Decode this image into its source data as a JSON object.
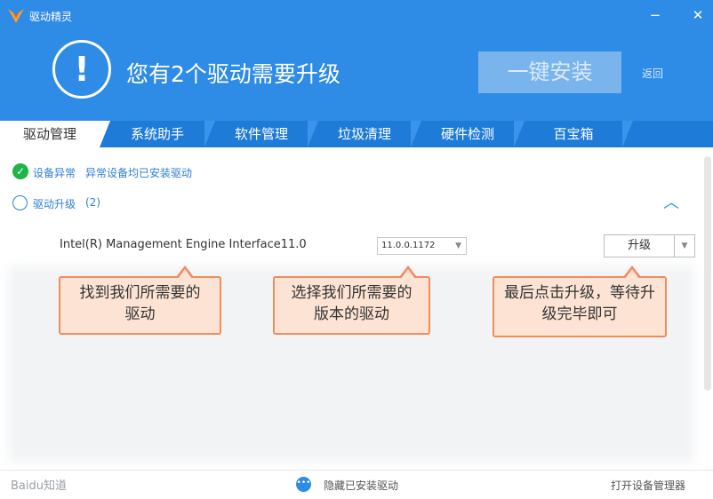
{
  "window": {
    "app_title": "驱动精灵",
    "minimize_glyph": "−",
    "close_glyph": "✕",
    "logo_icon": "app-logo-icon"
  },
  "header": {
    "alert_glyph": "!",
    "headline": "您有2个驱动需要升级",
    "install_button": "一键安装",
    "back_link": "返回"
  },
  "tabs": [
    {
      "label": "驱动管理",
      "active": true
    },
    {
      "label": "系统助手",
      "active": false
    },
    {
      "label": "软件管理",
      "active": false
    },
    {
      "label": "垃圾清理",
      "active": false
    },
    {
      "label": "硬件检测",
      "active": false
    },
    {
      "label": "百宝箱",
      "active": false
    }
  ],
  "status": {
    "device_error_label": "设备异常",
    "device_error_note": "异常设备均已安装驱动",
    "upgrade_label": "驱动升级",
    "upgrade_count": "(2)"
  },
  "driver": {
    "name": "Intel(R) Management Engine Interface11.0",
    "selected_version": "11.0.0.1172",
    "upgrade_button": "升级"
  },
  "callouts": [
    {
      "text": "找到我们所需要的驱动"
    },
    {
      "text": "选择我们所需要的版本的驱动"
    },
    {
      "text": "最后点击升级，等待升级完毕即可"
    }
  ],
  "footer": {
    "watermark": "Baidu知道",
    "more_glyph": "•••",
    "hide_installed": "隐藏已安装驱动",
    "open_device_manager": "打开设备管理器"
  },
  "colors": {
    "header_blue": "#2e8be6",
    "tab_bar_blue": "#1f7bd8",
    "callout_fill": "#fde3d4",
    "callout_border": "#ef8e5c",
    "ok_green": "#1fb546"
  }
}
